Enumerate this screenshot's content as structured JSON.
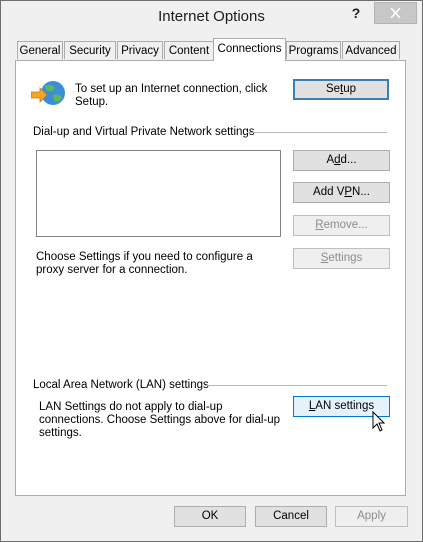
{
  "window": {
    "title": "Internet Options",
    "help": "?"
  },
  "tabs": [
    {
      "label": "General"
    },
    {
      "label": "Security"
    },
    {
      "label": "Privacy"
    },
    {
      "label": "Content"
    },
    {
      "label": "Connections"
    },
    {
      "label": "Programs"
    },
    {
      "label": "Advanced"
    }
  ],
  "setup": {
    "text": "To set up an Internet connection, click Setup.",
    "button_pre": "Se",
    "button_key": "t",
    "button_post": "up"
  },
  "dialup": {
    "group_label": "Dial-up and Virtual Private Network settings",
    "add_pre": "A",
    "add_key": "d",
    "add_post": "d...",
    "vpn_pre": "Add V",
    "vpn_key": "P",
    "vpn_post": "N...",
    "remove_pre": "",
    "remove_key": "R",
    "remove_post": "emove...",
    "settings_pre": "",
    "settings_key": "S",
    "settings_post": "ettings",
    "proxy_text": "Choose Settings if you need to configure a proxy server for a connection."
  },
  "lan": {
    "group_label": "Local Area Network (LAN) settings",
    "text": "LAN Settings do not apply to dial-up connections. Choose Settings above for dial-up settings.",
    "button_pre": "",
    "button_key": "L",
    "button_post": "AN settings"
  },
  "footer": {
    "ok": "OK",
    "cancel": "Cancel",
    "apply": "Apply"
  }
}
